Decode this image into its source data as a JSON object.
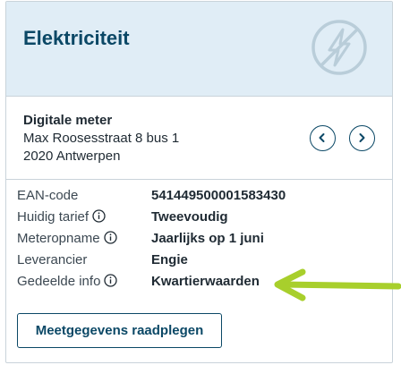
{
  "card": {
    "title": "Elektriciteit",
    "icon": "lightning-bolt-icon"
  },
  "meter": {
    "label": "Digitale meter",
    "address_line1": "Max Roosesstraat 8 bus 1",
    "address_line2": "2020 Antwerpen",
    "prev_icon": "chevron-left-icon",
    "next_icon": "chevron-right-icon"
  },
  "details": [
    {
      "label": "EAN-code",
      "value": "541449500001583430",
      "info": false
    },
    {
      "label": "Huidig tarief",
      "value": "Tweevoudig",
      "info": true
    },
    {
      "label": "Meteropname",
      "value": "Jaarlijks op 1 juni",
      "info": true
    },
    {
      "label": "Leverancier",
      "value": "Engie",
      "info": false
    },
    {
      "label": "Gedeelde info",
      "value": "Kwartierwaarden",
      "info": true
    }
  ],
  "action": {
    "label": "Meetgegevens raadplegen"
  },
  "colors": {
    "brand": "#0b4866",
    "header_bg": "#e0edf6",
    "annotation_arrow": "#a8cf2c"
  }
}
